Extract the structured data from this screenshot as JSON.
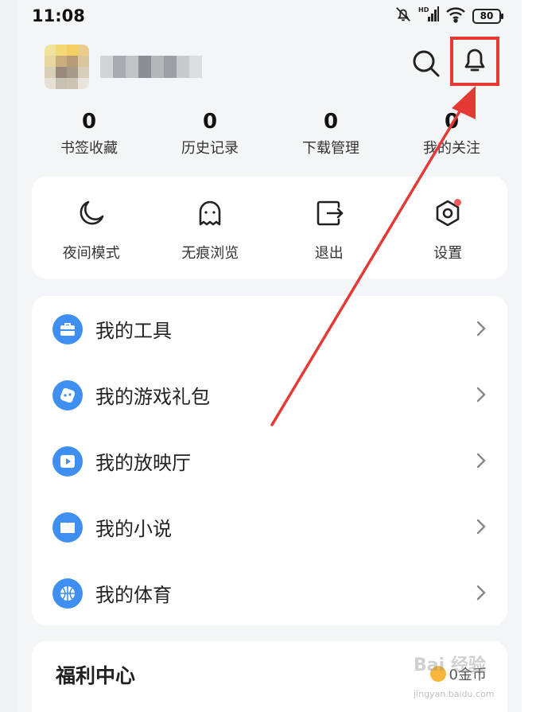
{
  "status_bar": {
    "time": "11:08",
    "battery": "80",
    "icons": [
      "bell-muted-icon",
      "signal-hd-icon",
      "wifi-icon",
      "battery-icon"
    ]
  },
  "profile": {
    "avatar_icon": "avatar-blurred",
    "username_icon": "username-blurred"
  },
  "header_actions": {
    "search_icon": "search-icon",
    "bell_icon": "bell-icon",
    "highlight_color": "#e53935"
  },
  "stats": [
    {
      "count": "0",
      "label": "书签收藏"
    },
    {
      "count": "0",
      "label": "历史记录"
    },
    {
      "count": "0",
      "label": "下载管理"
    },
    {
      "count": "0",
      "label": "我的关注"
    }
  ],
  "quick_actions": [
    {
      "label": "夜间模式",
      "icon": "moon-icon"
    },
    {
      "label": "无痕浏览",
      "icon": "ghost-icon"
    },
    {
      "label": "退出",
      "icon": "exit-icon"
    },
    {
      "label": "设置",
      "icon": "settings-icon"
    }
  ],
  "menu": [
    {
      "label": "我的工具",
      "icon": "toolbox-icon"
    },
    {
      "label": "我的游戏礼包",
      "icon": "gamepad-icon"
    },
    {
      "label": "我的放映厅",
      "icon": "play-icon"
    },
    {
      "label": "我的小说",
      "icon": "book-icon"
    },
    {
      "label": "我的体育",
      "icon": "basketball-icon"
    }
  ],
  "welfare": {
    "title": "福利中心",
    "coins_label": "0金币"
  },
  "watermark": {
    "text": "Bai 经验",
    "url": "jingyan.baidu.com"
  },
  "colors": {
    "accent_blue": "#3f8ff0",
    "arrow_red": "#e53935",
    "badge_red": "#f25a5a",
    "page_bg": "#f4f5f9"
  }
}
